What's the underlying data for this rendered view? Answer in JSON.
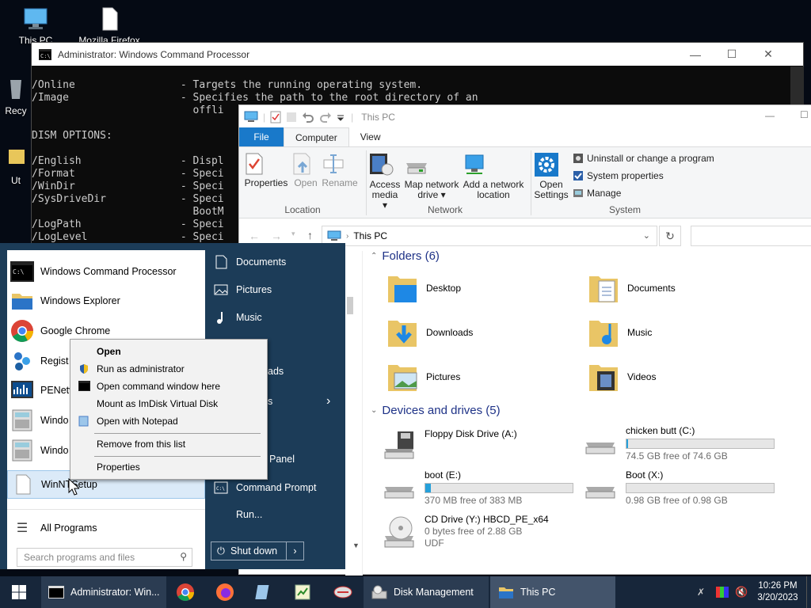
{
  "desktop": {
    "icons": [
      {
        "label": "This PC",
        "icon": "computer-icon"
      },
      {
        "label": "Mozilla Firefox",
        "icon": "file-icon"
      },
      {
        "label": "Recy",
        "icon": "recycle-bin-icon"
      },
      {
        "label": "Ut",
        "icon": "folder-icon"
      }
    ]
  },
  "cmd": {
    "title": "Administrator: Windows Command Processor",
    "lines": [
      "/Online                 - Targets the running operating system.",
      "/Image                  - Specifies the path to the root directory of an",
      "                          offli",
      "",
      "DISM OPTIONS:",
      "",
      "/English                - Displ",
      "/Format                 - Speci",
      "/WinDir                 - Speci",
      "/SysDriveDir            - Speci",
      "                          BootM",
      "/LogPath                - Speci",
      "/LogLevel               - Speci"
    ]
  },
  "explorer": {
    "title": "This PC",
    "tabs": {
      "file": "File",
      "computer": "Computer",
      "view": "View"
    },
    "ribbon": {
      "location": {
        "group": "Location",
        "properties": "Properties",
        "open": "Open",
        "rename": "Rename"
      },
      "network": {
        "group": "Network",
        "access_media_1": "Access",
        "access_media_2": "media",
        "map_drive_1": "Map network",
        "map_drive_2": "drive",
        "add_loc_1": "Add a network",
        "add_loc_2": "location"
      },
      "system": {
        "group": "System",
        "open_settings_1": "Open",
        "open_settings_2": "Settings",
        "uninstall": "Uninstall or change a program",
        "sys_props": "System properties",
        "manage": "Manage"
      }
    },
    "address": "This PC",
    "folders_header": "Folders (6)",
    "folders": [
      "Desktop",
      "Documents",
      "Downloads",
      "Music",
      "Pictures",
      "Videos"
    ],
    "devices_header": "Devices and drives (5)",
    "drives": [
      {
        "name": "Floppy Disk Drive (A:)",
        "free": "",
        "fill": null
      },
      {
        "name": "chicken butt (C:)",
        "free": "74.5 GB free of 74.6 GB",
        "fill": 0.01
      },
      {
        "name": "boot (E:)",
        "free": "370 MB free of 383 MB",
        "fill": 0.04
      },
      {
        "name": "Boot (X:)",
        "free": "0.98 GB free of 0.98 GB",
        "fill": 0.0
      },
      {
        "name": "CD Drive (Y:) HBCD_PE_x64",
        "free": "0 bytes free of 2.88 GB",
        "fs": "UDF",
        "fill": null
      }
    ]
  },
  "start_menu": {
    "items": [
      "Windows Command Processor",
      "Windows Explorer",
      "Google Chrome",
      "Regist",
      "PENetv",
      "Windo",
      "Windo",
      "WinNTSetup"
    ],
    "all_programs": "All Programs",
    "search_placeholder": "Search programs and files",
    "right": {
      "documents": "Documents",
      "pictures": "Pictures",
      "music": "Music",
      "downloads_partial": "ads",
      "settings_partial": "s",
      "control_panel_partial": "Panel",
      "command_prompt": "Command Prompt",
      "run": "Run..."
    },
    "shutdown": "Shut down"
  },
  "context_menu": {
    "open": "Open",
    "run_admin": "Run as administrator",
    "open_cmd": "Open command window here",
    "mount": "Mount as ImDisk Virtual Disk",
    "notepad": "Open with Notepad",
    "remove": "Remove from this list",
    "properties": "Properties"
  },
  "taskbar": {
    "cmd_task": "Administrator: Win...",
    "disk_task": "Disk Management",
    "thispc_task": "This PC",
    "time": "10:26 PM",
    "date": "3/20/2023"
  },
  "colors": {
    "accent": "#1979ca",
    "start_bg": "#1c3c58",
    "taskbar_bg": "#17263a",
    "link": "#1e3287"
  }
}
